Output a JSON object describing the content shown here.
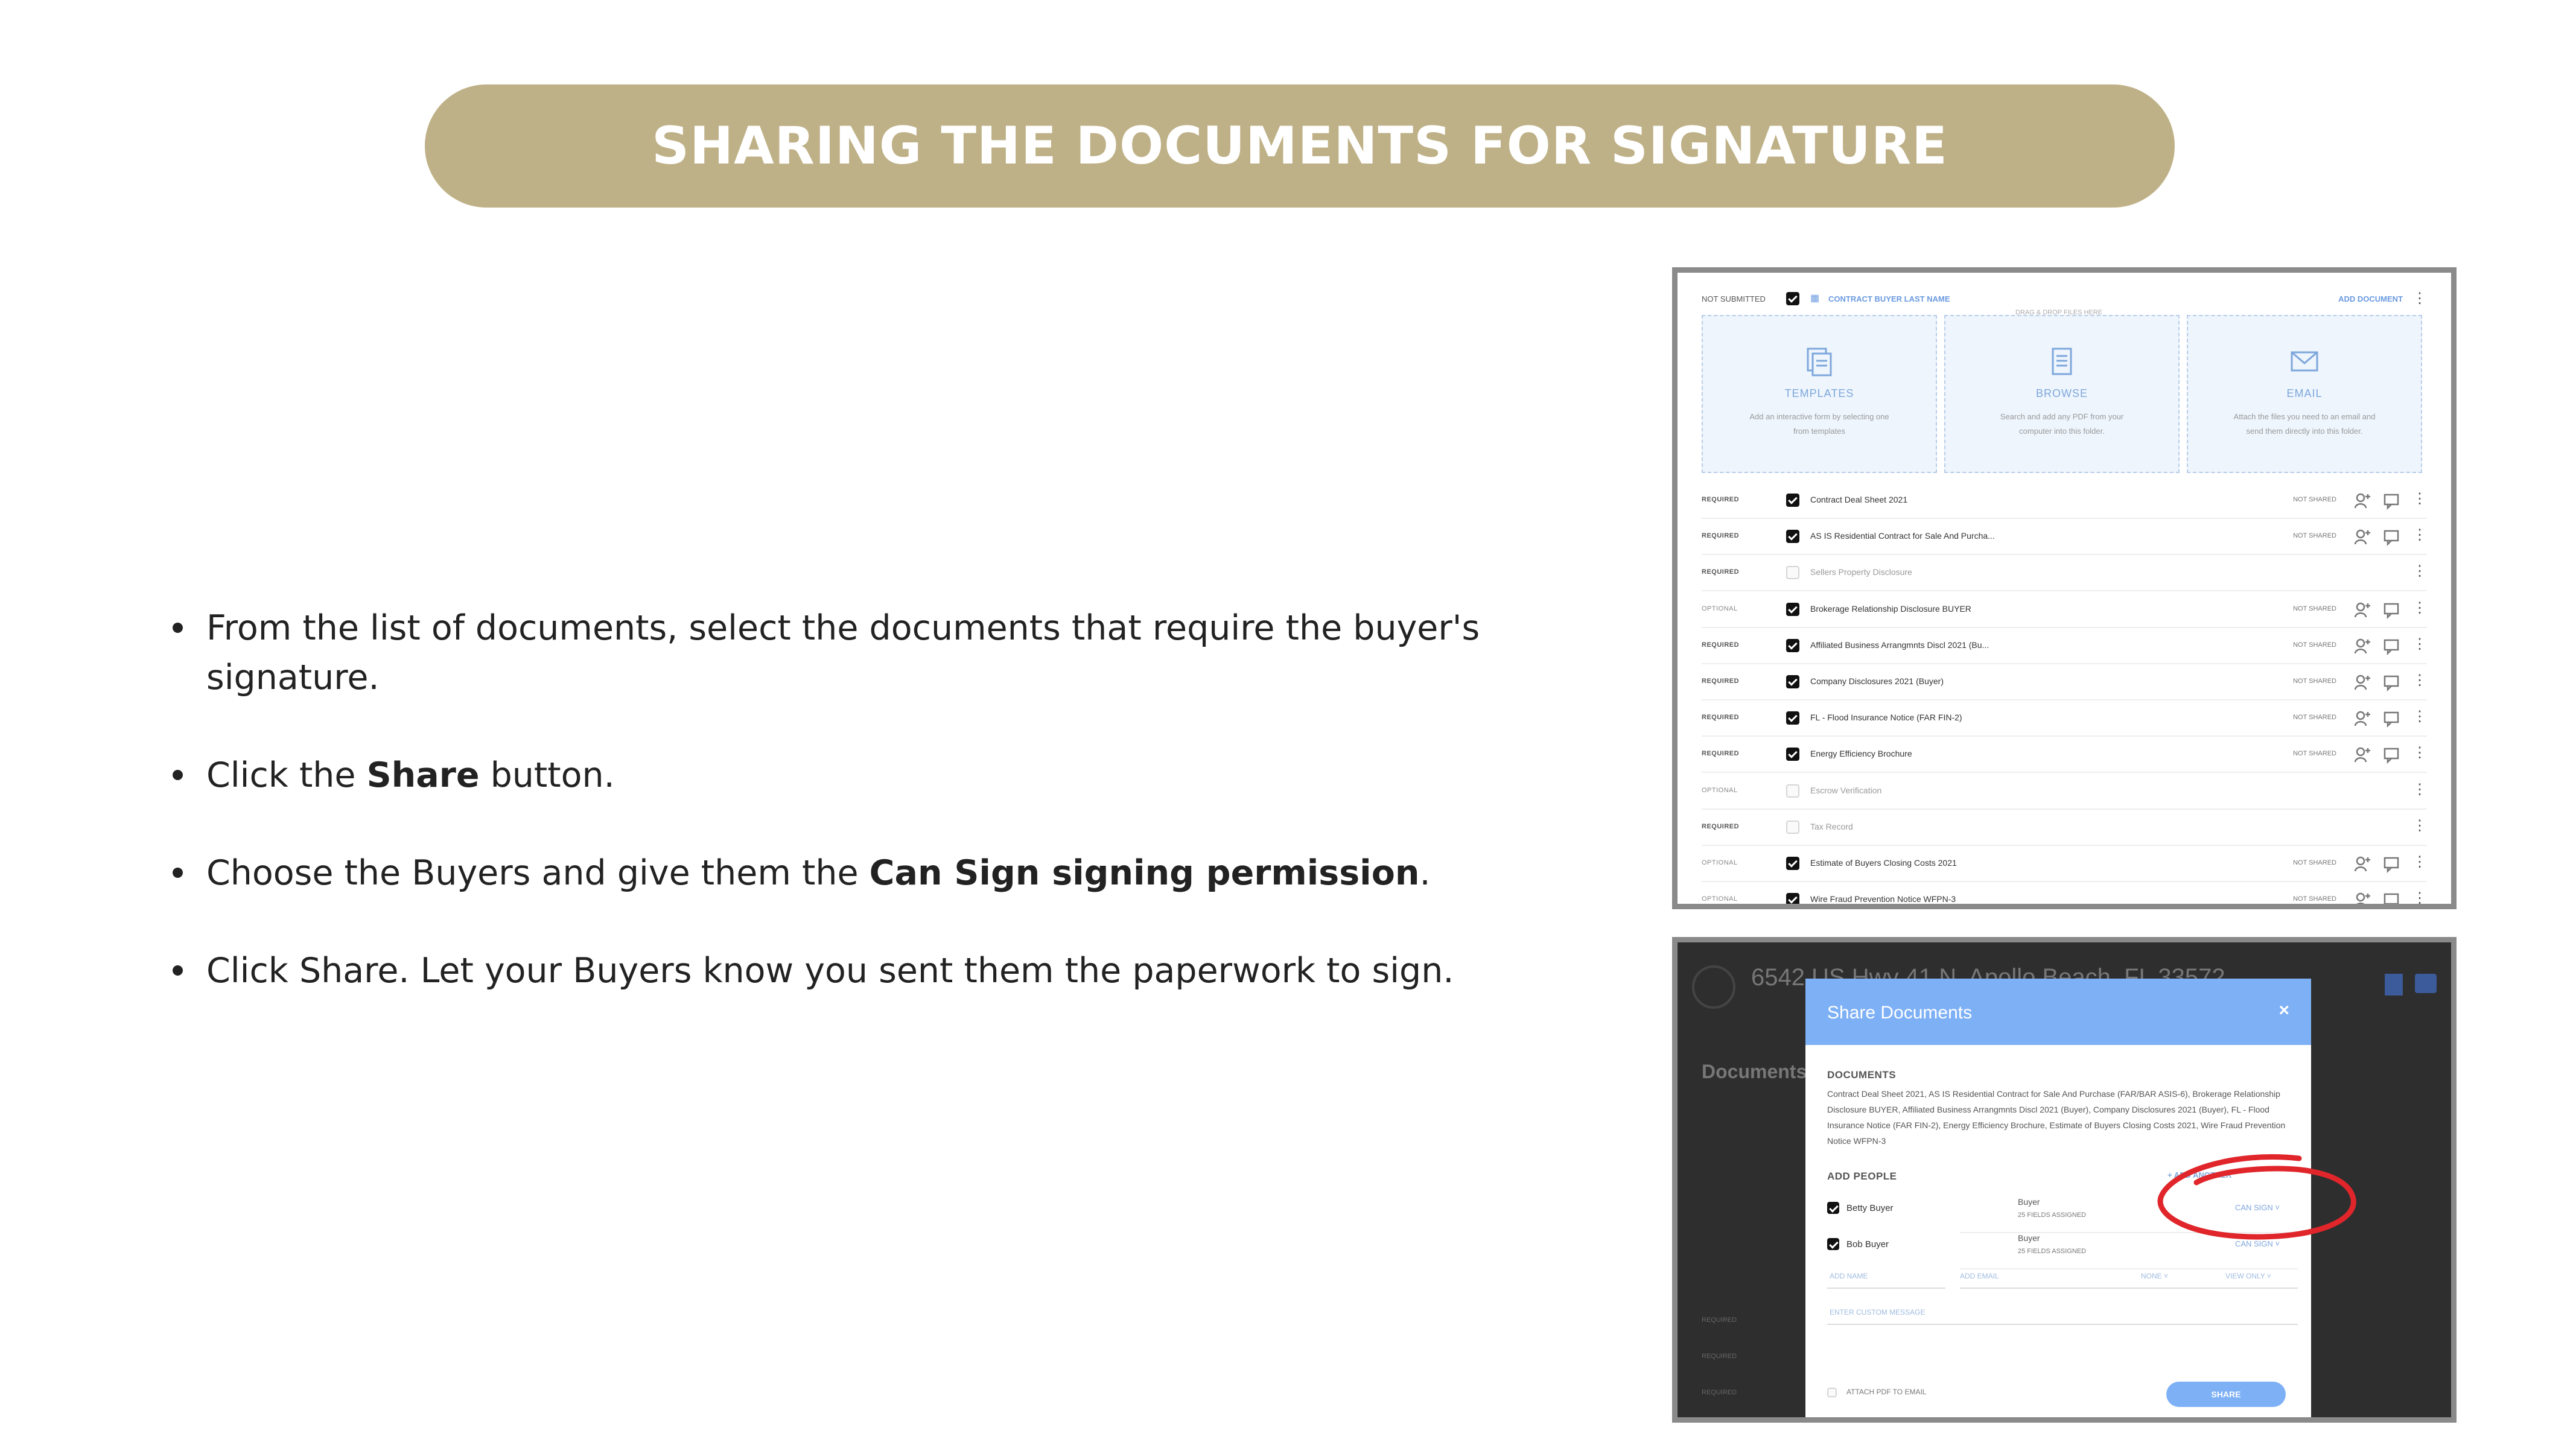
{
  "title": "SHARING THE DOCUMENTS FOR SIGNATURE",
  "bullets": [
    {
      "pre": "From the list of documents, select the documents that require the buyer's signature.",
      "bold": "",
      "post": ""
    },
    {
      "pre": "Click the ",
      "bold": "Share",
      "post": " button."
    },
    {
      "pre": "Choose the Buyers and give them the ",
      "bold": "Can Sign signing permission",
      "post": "."
    },
    {
      "pre": "Click Share. Let your Buyers know you sent them the paperwork to sign.",
      "bold": "",
      "post": ""
    }
  ],
  "documents_panel": {
    "folder_status": "NOT SUBMITTED",
    "folder_name": "CONTRACT BUYER LAST NAME",
    "add_document": "ADD DOCUMENT",
    "drag_drop_label": "DRAG & DROP FILES HERE",
    "cards": [
      {
        "icon": "templates-icon",
        "title": "TEMPLATES",
        "desc": "Add an interactive form by selecting one from templates"
      },
      {
        "icon": "browse-icon",
        "title": "BROWSE",
        "desc": "Search and add any PDF from your computer into this folder."
      },
      {
        "icon": "email-icon",
        "title": "EMAIL",
        "desc": "Attach the files you need to an email and send them directly into this folder."
      }
    ],
    "rows": [
      {
        "requirement": "REQUIRED",
        "checked": true,
        "name": "Contract Deal Sheet 2021",
        "status": "NOT SHARED"
      },
      {
        "requirement": "REQUIRED",
        "checked": true,
        "name": "AS IS Residential Contract for Sale And Purcha...",
        "status": "NOT SHARED"
      },
      {
        "requirement": "REQUIRED",
        "checked": false,
        "name": "Sellers Property Disclosure",
        "status": ""
      },
      {
        "requirement": "OPTIONAL",
        "checked": true,
        "name": "Brokerage Relationship Disclosure BUYER",
        "status": "NOT SHARED"
      },
      {
        "requirement": "REQUIRED",
        "checked": true,
        "name": "Affiliated Business Arrangmnts Discl 2021 (Bu...",
        "status": "NOT SHARED"
      },
      {
        "requirement": "REQUIRED",
        "checked": true,
        "name": "Company Disclosures 2021 (Buyer)",
        "status": "NOT SHARED"
      },
      {
        "requirement": "REQUIRED",
        "checked": true,
        "name": "FL - Flood Insurance Notice (FAR FIN-2)",
        "status": "NOT SHARED"
      },
      {
        "requirement": "REQUIRED",
        "checked": true,
        "name": "Energy Efficiency Brochure",
        "status": "NOT SHARED"
      },
      {
        "requirement": "OPTIONAL",
        "checked": false,
        "name": "Escrow Verification",
        "status": ""
      },
      {
        "requirement": "REQUIRED",
        "checked": false,
        "name": "Tax Record",
        "status": ""
      },
      {
        "requirement": "OPTIONAL",
        "checked": true,
        "name": "Estimate of Buyers Closing Costs 2021",
        "status": "NOT SHARED"
      },
      {
        "requirement": "OPTIONAL",
        "checked": true,
        "name": "Wire Fraud Prevention Notice WFPN-3",
        "status": "NOT SHARED"
      }
    ]
  },
  "share_modal": {
    "background_address": "6542 US Hwy 41 N, Apollo Beach, FL 33572",
    "background_heading": "Documents",
    "title": "Share Documents",
    "close": "×",
    "documents_label": "DOCUMENTS",
    "documents_list": "Contract Deal Sheet 2021, AS IS Residential Contract for Sale And Purchase (FAR/BAR ASIS-6), Brokerage Relationship Disclosure BUYER, Affiliated Business Arrangmnts Discl 2021 (Buyer), Company Disclosures 2021 (Buyer), FL - Flood Insurance Notice (FAR FIN-2), Energy Efficiency Brochure, Estimate of Buyers Closing Costs 2021, Wire Fraud Prevention Notice WFPN-3",
    "add_people_label": "ADD PEOPLE",
    "add_another": "+ ADD ANOTHER",
    "people": [
      {
        "name": "Betty Buyer",
        "role": "Buyer",
        "fields": "25 FIELDS ASSIGNED",
        "permission": "CAN SIGN ˅",
        "checked": true
      },
      {
        "name": "Bob Buyer",
        "role": "Buyer",
        "fields": "25 FIELDS ASSIGNED",
        "permission": "CAN SIGN ˅",
        "checked": true
      }
    ],
    "add_name_placeholder": "ADD NAME",
    "add_email_placeholder": "ADD EMAIL",
    "role_select": "NONE ˅",
    "permission_select": "VIEW ONLY ˅",
    "custom_message": "ENTER CUSTOM MESSAGE",
    "attach_pdf": "ATTACH PDF TO EMAIL",
    "share_button": "SHARE"
  },
  "colors": {
    "title_pill": "#bfb187",
    "accent_blue": "#7eb0f6",
    "annotation_red": "#e0262b"
  }
}
